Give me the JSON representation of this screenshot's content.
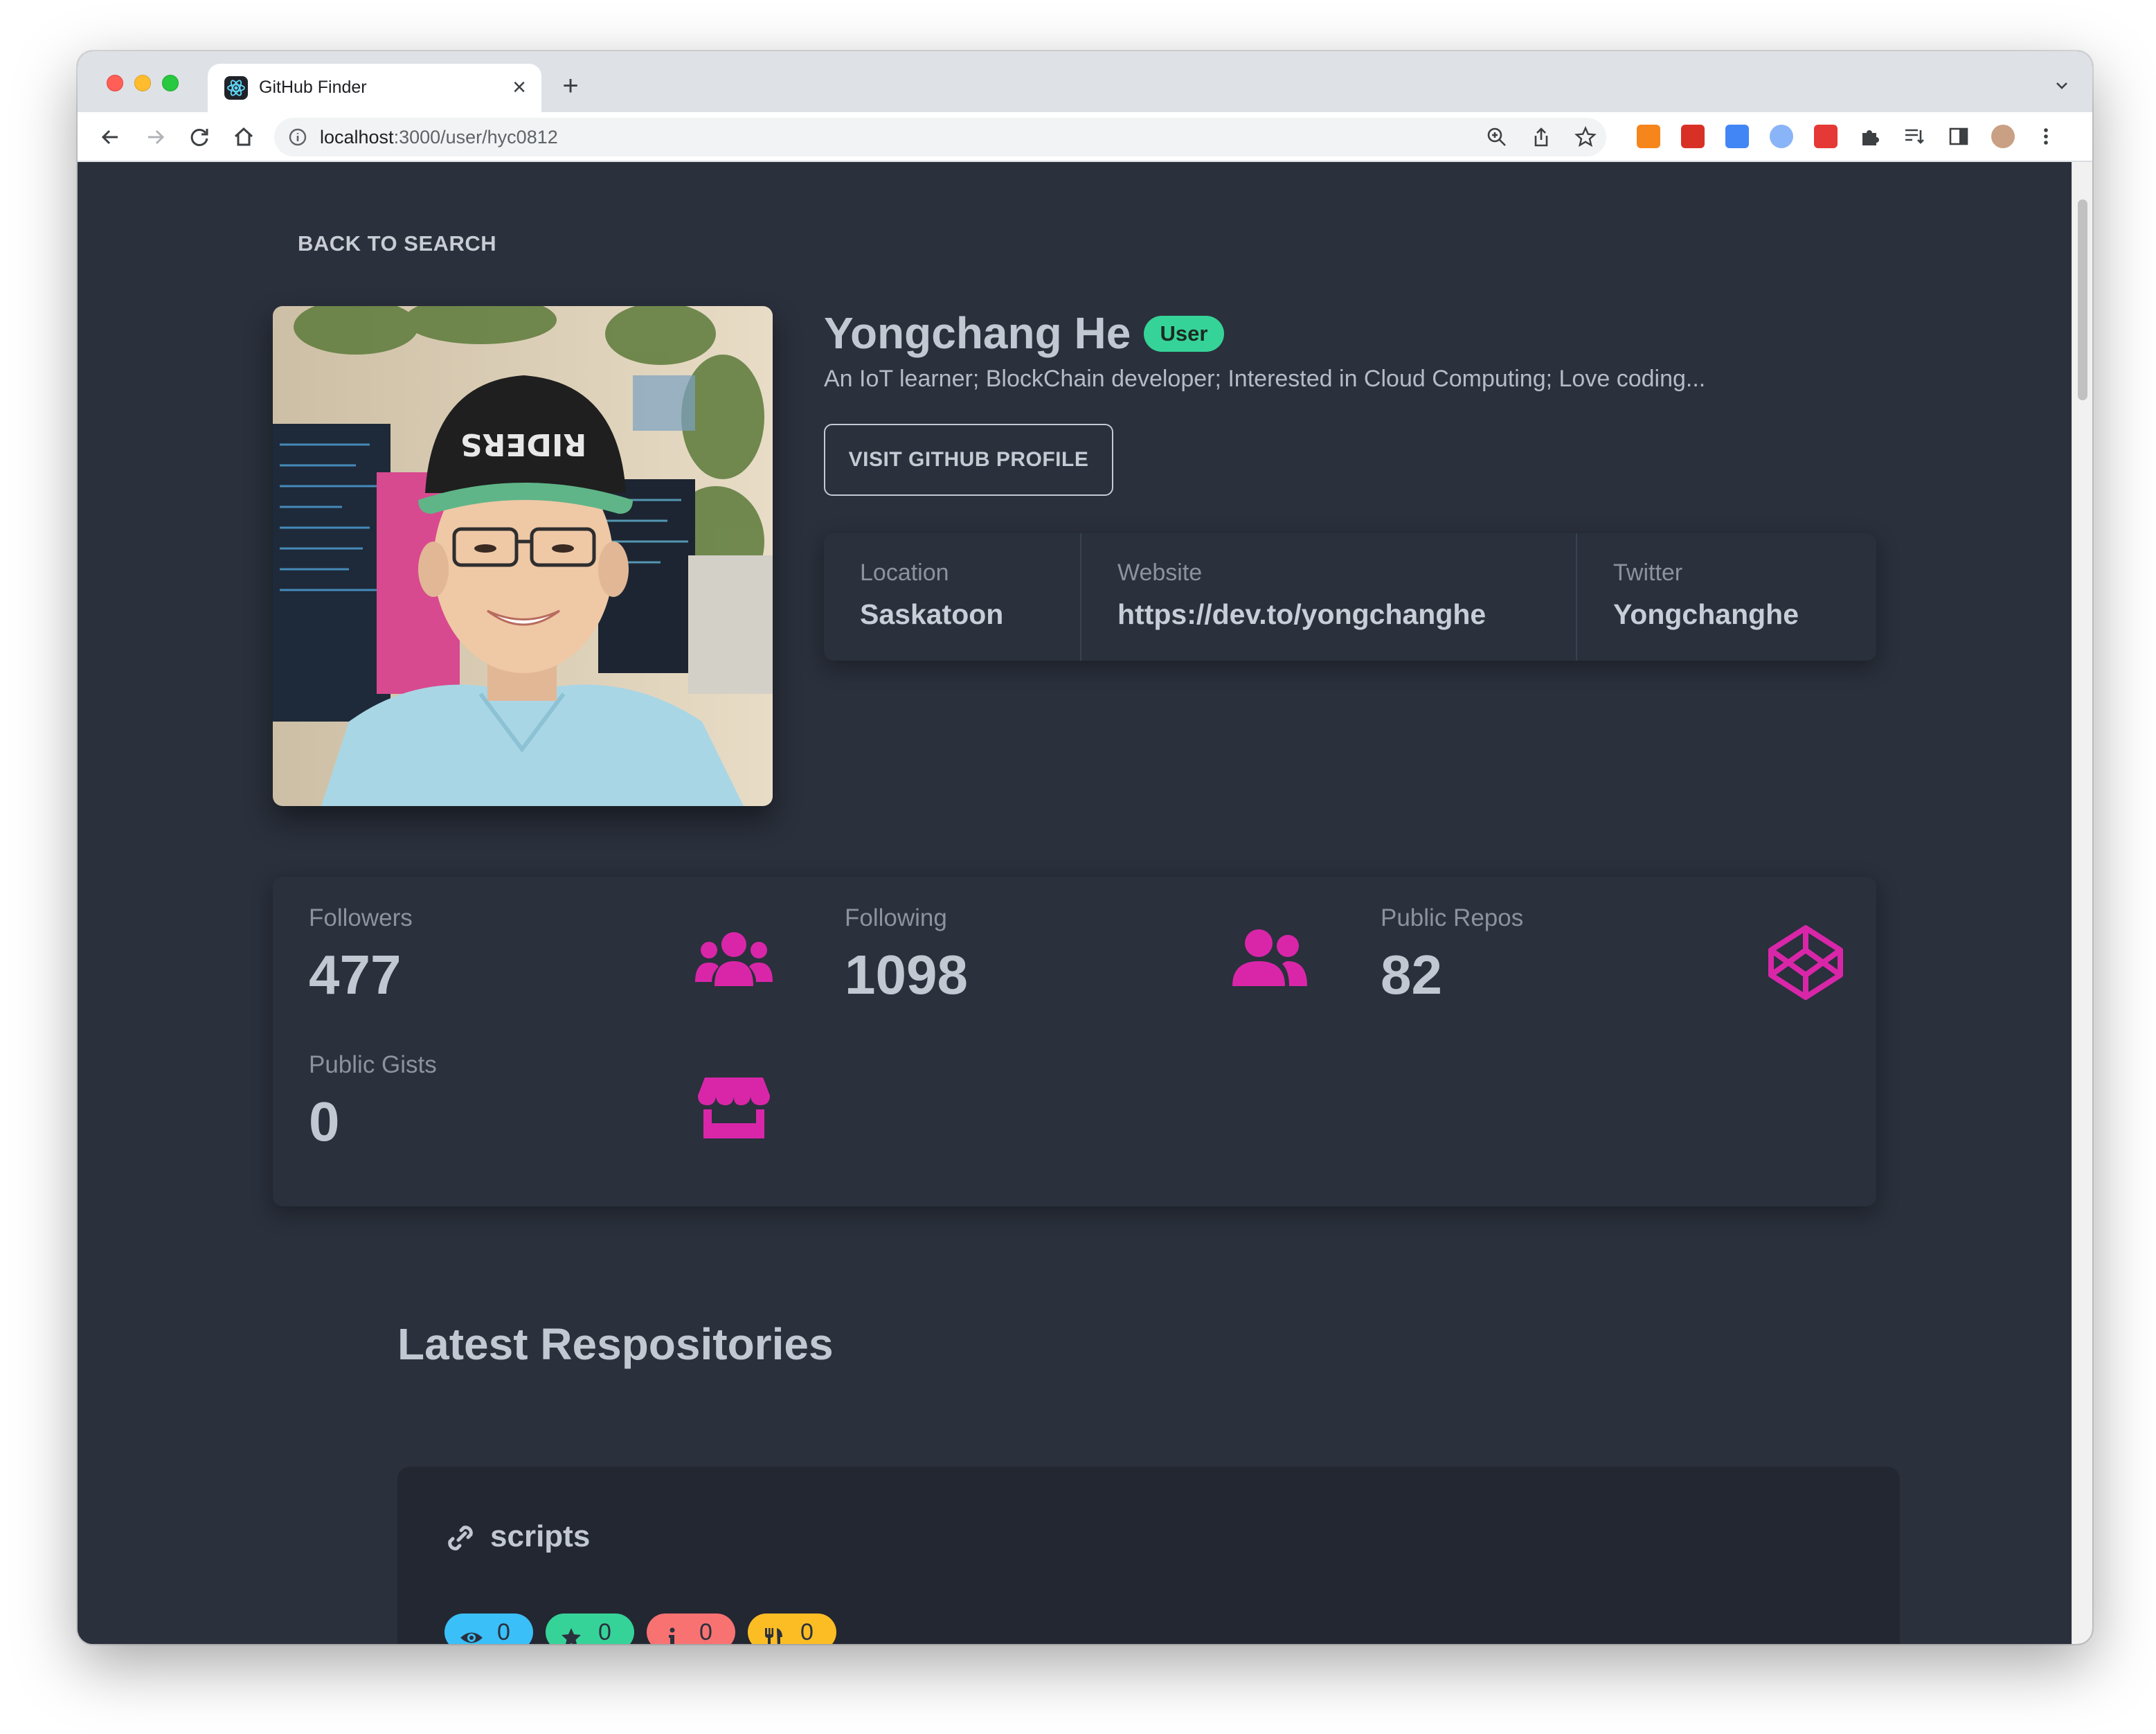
{
  "browser": {
    "tab_title": "GitHub Finder",
    "url_host": "localhost",
    "url_path": ":3000/user/hyc0812"
  },
  "page": {
    "back_label": "BACK TO SEARCH",
    "profile": {
      "name": "Yongchang He",
      "badge": "User",
      "bio": "An IoT learner; BlockChain developer; Interested in Cloud Computing; Love coding...",
      "visit_button": "VISIT GITHUB PROFILE",
      "location_label": "Location",
      "location": "Saskatoon",
      "website_label": "Website",
      "website": "https://dev.to/yongchanghe",
      "twitter_label": "Twitter",
      "twitter": "Yongchanghe"
    },
    "stats": {
      "followers_label": "Followers",
      "followers": "477",
      "following_label": "Following",
      "following": "1098",
      "repos_label": "Public Repos",
      "repos": "82",
      "gists_label": "Public Gists",
      "gists": "0"
    },
    "repos_section": {
      "title": "Latest Respositories",
      "items": [
        {
          "name": "scripts",
          "watchers": "0",
          "stars": "0",
          "issues": "0",
          "forks": "0"
        }
      ]
    }
  },
  "colors": {
    "bg": "#2a303c",
    "accent_pink": "#d926a9",
    "badge_green": "#36d399",
    "pill_blue": "#3abff8",
    "pill_red": "#f87272",
    "pill_yellow": "#fbbd23"
  },
  "icons": [
    "react-icon",
    "users-icon",
    "user-friends-icon",
    "codepen-icon",
    "store-icon",
    "link-icon",
    "eye-icon",
    "star-icon",
    "info-icon",
    "utensils-icon"
  ]
}
